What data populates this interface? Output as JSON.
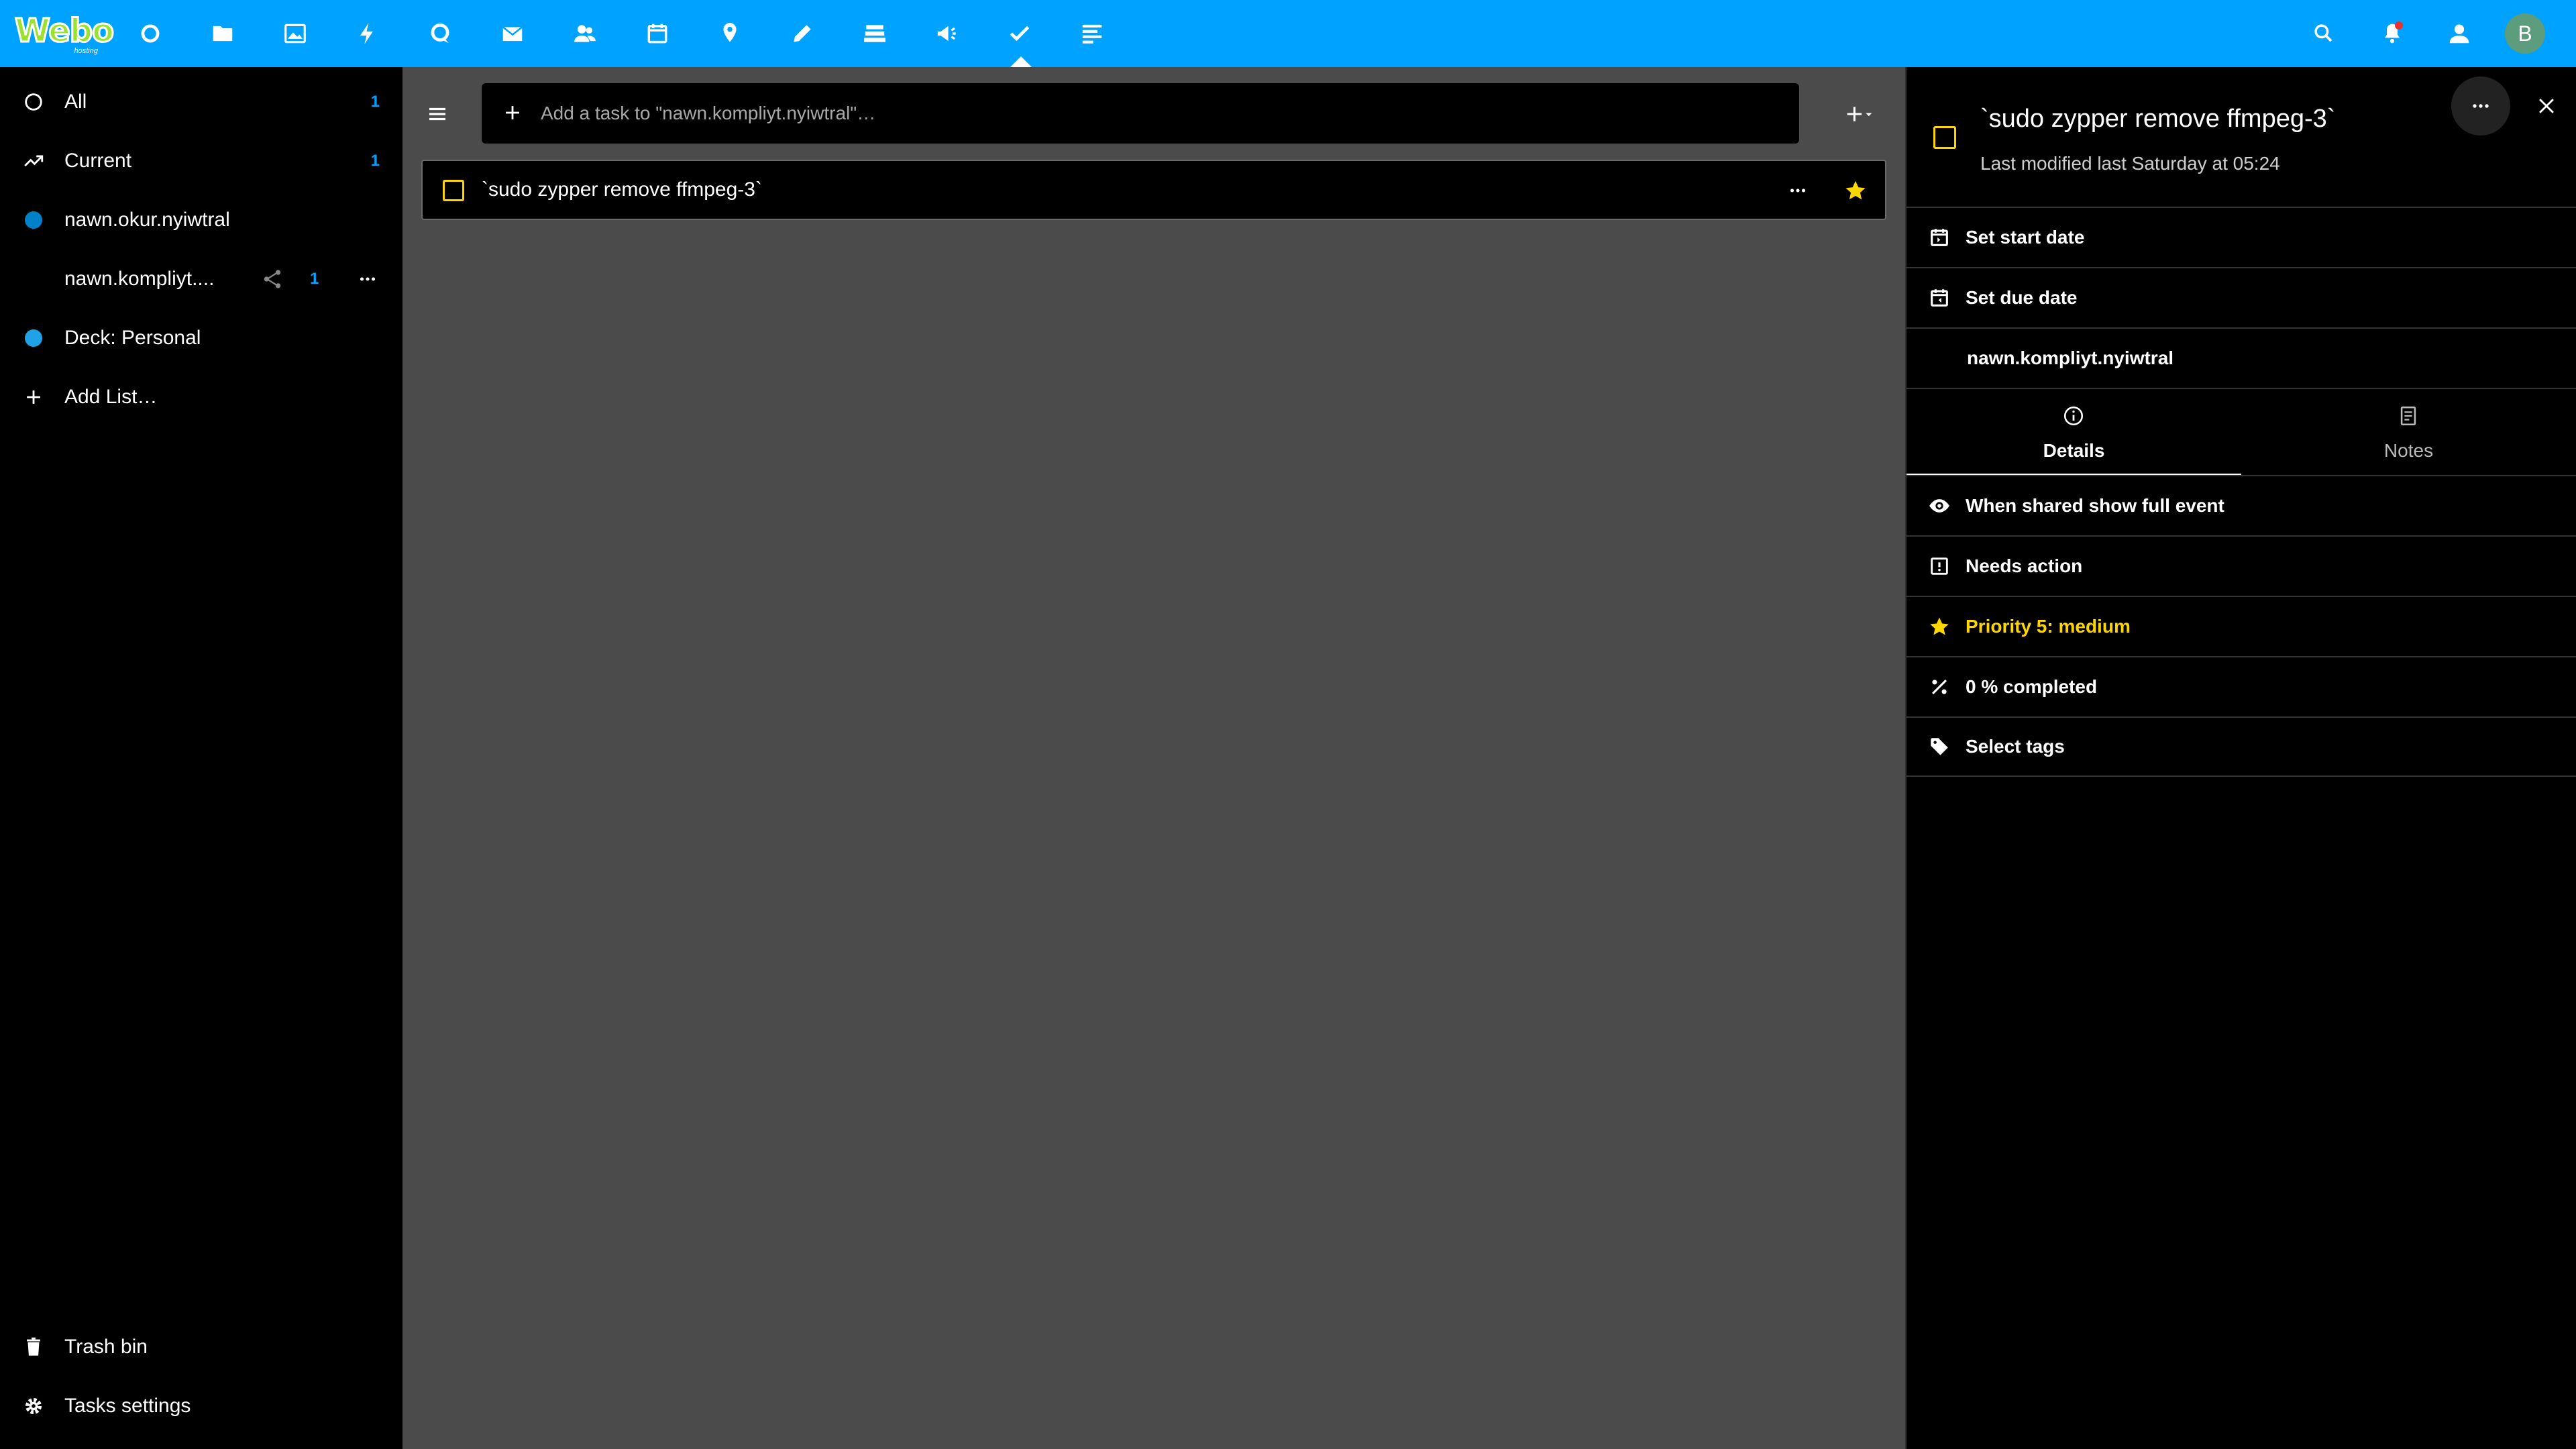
{
  "header": {
    "logo_text": "Webo",
    "logo_sub": "hosting",
    "apps": [
      "dashboard-icon",
      "files-icon",
      "photos-icon",
      "activity-icon",
      "talk-icon",
      "mail-icon",
      "contacts-icon",
      "calendar-icon",
      "maps-icon",
      "notes-icon",
      "deck-icon",
      "announcements-icon",
      "tasks-icon",
      "forms-icon"
    ],
    "avatar_initial": "B",
    "colors": {
      "bar": "#00a2ff",
      "notification_dot": "#e9322d"
    }
  },
  "nav": {
    "items": [
      {
        "label": "All",
        "count": "1"
      },
      {
        "label": "Current",
        "count": "1"
      },
      {
        "label": "nawn.okur.nyiwtral"
      },
      {
        "label": "nawn.kompliyt....",
        "count": "1"
      },
      {
        "label": "Deck: Personal"
      },
      {
        "label": "Add List…"
      }
    ],
    "trash_label": "Trash bin",
    "settings_label": "Tasks settings"
  },
  "main": {
    "add_placeholder": "Add a task to \"nawn.kompliyt.nyiwtral\"…",
    "tasks": [
      {
        "title": "`sudo zypper remove ffmpeg-3`"
      }
    ]
  },
  "detail": {
    "title": "`sudo zypper remove ffmpeg-3`",
    "last_modified": "Last modified last Saturday at 05:24",
    "start_date_label": "Set start date",
    "due_date_label": "Set due date",
    "calendar_name": "nawn.kompliyt.nyiwtral",
    "tabs": [
      {
        "label": "Details"
      },
      {
        "label": "Notes"
      }
    ],
    "classification": "When shared show full event",
    "status": "Needs action",
    "priority": "Priority 5: medium",
    "percent": "0 % completed",
    "tags": "Select tags",
    "colors": {
      "priority": "#ffd700",
      "checkbox": "#ffd700"
    }
  }
}
